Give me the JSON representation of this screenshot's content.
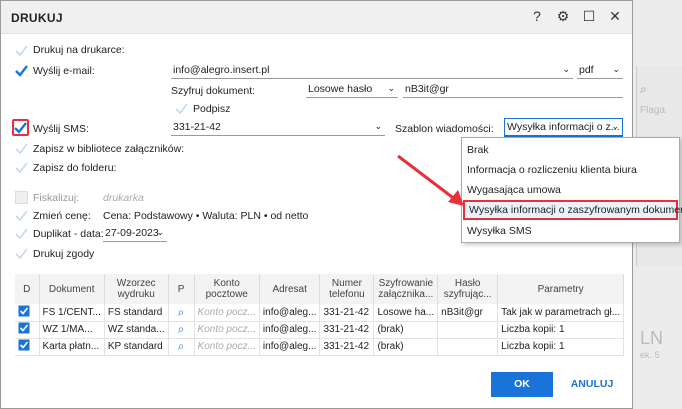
{
  "dialog": {
    "title": "DRUKUJ"
  },
  "titlebar": {
    "help": "?",
    "settings": "⚙",
    "maximize": "☐",
    "close": "✕"
  },
  "options": {
    "print": "Drukuj na drukarce:",
    "email": "Wyślij e-mail:",
    "email_value": "info@alegro.insert.pl",
    "format": "pdf",
    "encrypt_label": "Szyfruj dokument:",
    "encrypt_value": "Losowe hasło",
    "password_value": "nB3it@gr",
    "sign": "Podpisz",
    "sms": "Wyślij SMS:",
    "sms_value": "331-21-42",
    "template_label": "Szablon wiadomości:",
    "template_value": "Wysyłka informacji o z...",
    "attach_lib": "Zapisz w bibliotece załączników:",
    "save_folder": "Zapisz do folderu:",
    "fiscalize": "Fiskalizuj:",
    "fiscalize_value": "drukarka",
    "change_price": "Zmień cenę:",
    "price_value": "Cena: Podstawowy • Waluta: PLN • od netto",
    "duplicate": "Duplikat - data:",
    "duplicate_value": "27-09-2023",
    "consent": "Drukuj zgody"
  },
  "dropdown": {
    "items": [
      "Brak",
      "Informacja o rozliczeniu klienta biura",
      "Wygasająca umowa",
      "Wysyłka informacji o zaszyfrowanym dokumencie",
      "Wysyłka SMS"
    ]
  },
  "table": {
    "headers": [
      "D",
      "Dokument",
      "Wzorzec wydruku",
      "P",
      "Konto pocztowe",
      "Adresat",
      "Numer telefonu",
      "Szyfrowanie załącznika...",
      "Hasło szyfrując...",
      "Parametry"
    ],
    "rows": [
      [
        "FS 1/CENT...",
        "FS standard",
        "Konto pocz...",
        "info@aleg...",
        "331-21-42",
        "Losowe ha...",
        "nB3it@gr",
        "Tak jak w parametrach gł..."
      ],
      [
        "WZ 1/MA...",
        "WZ standa...",
        "Konto pocz...",
        "info@aleg...",
        "331-21-42",
        "(brak)",
        "",
        "Liczba kopii: 1"
      ],
      [
        "Karta płatn...",
        "KP standard",
        "Konto pocz...",
        "info@aleg...",
        "331-21-42",
        "(brak)",
        "",
        "Liczba kopii: 1"
      ]
    ]
  },
  "buttons": {
    "ok": "OK",
    "cancel": "ANULUJ"
  },
  "backdrop": {
    "label": "Flaga",
    "big": "LN",
    "small": "ek. 5"
  },
  "colors": {
    "accent": "#1a73d9",
    "highlight": "#e8303a",
    "check": "#1a73d9"
  }
}
